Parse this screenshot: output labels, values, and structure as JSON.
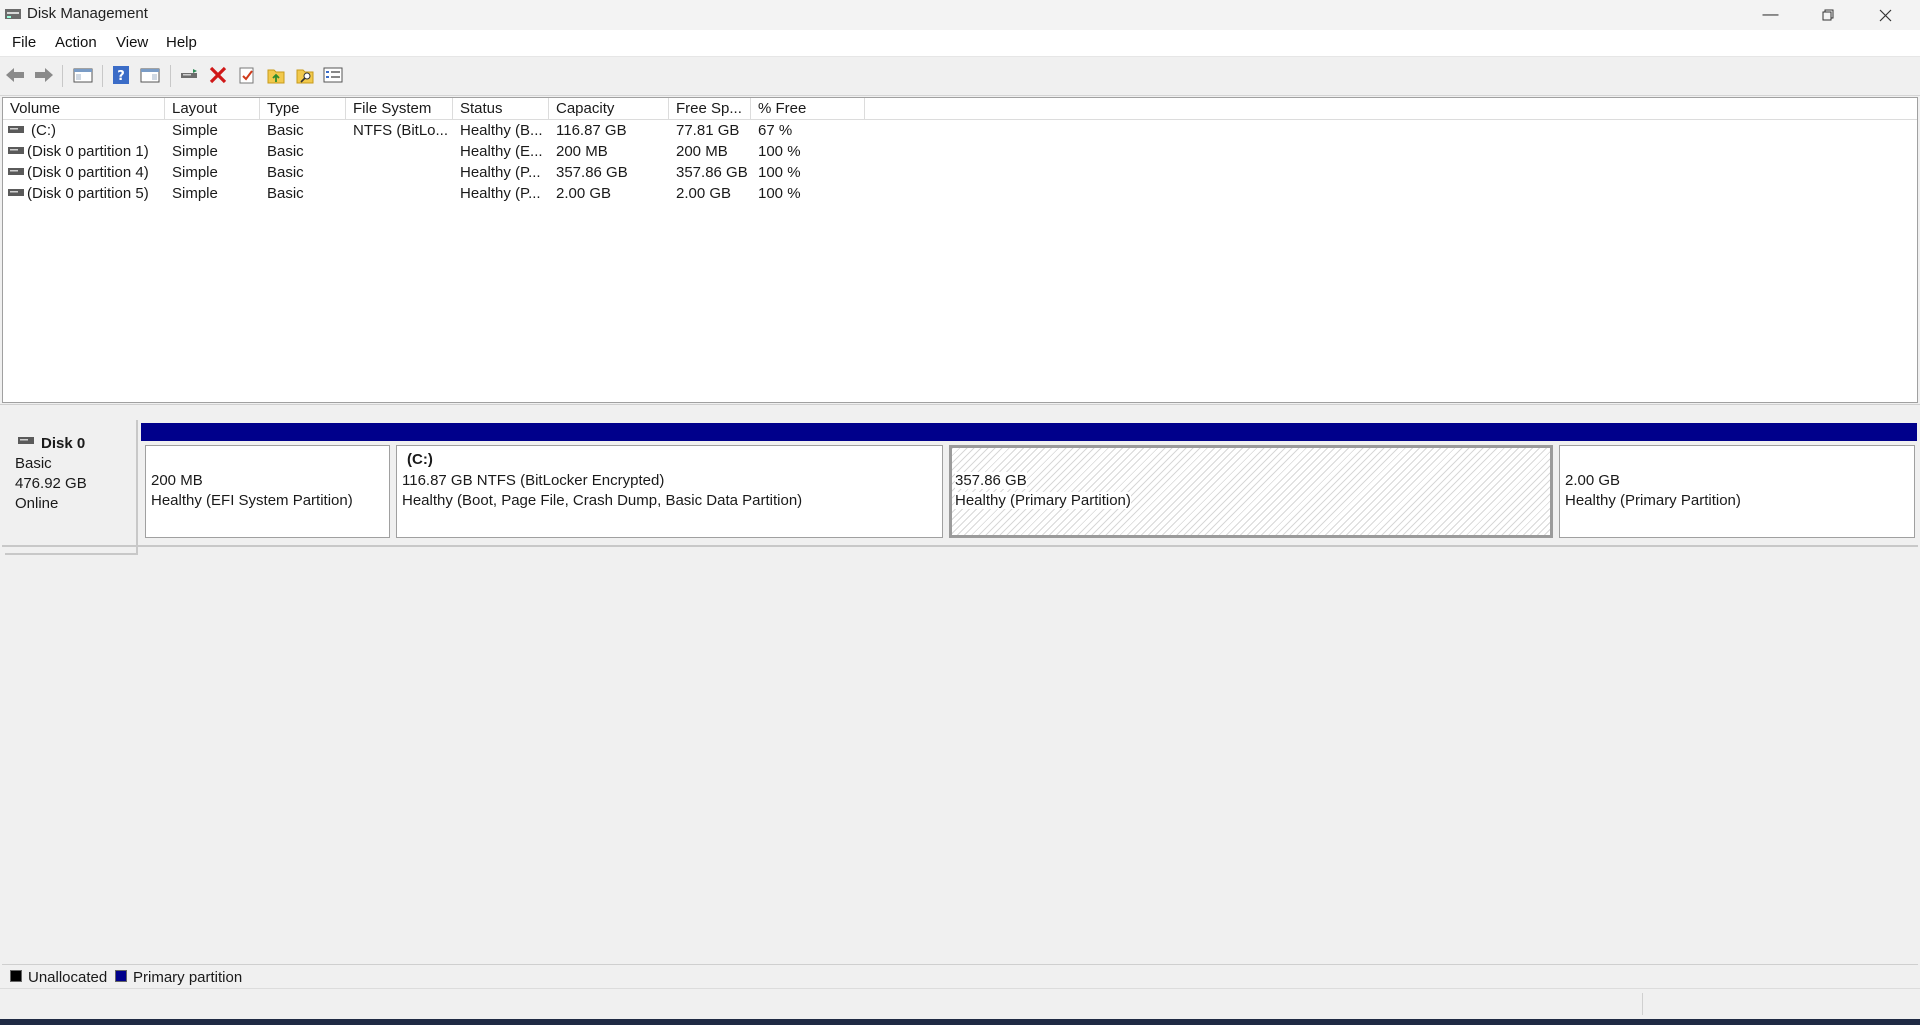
{
  "window": {
    "title": "Disk Management"
  },
  "menu": [
    "File",
    "Action",
    "View",
    "Help"
  ],
  "toolbar_icons": [
    "back-arrow-icon",
    "forward-arrow-icon",
    "console-tree-icon",
    "help-icon",
    "show-hide-icon",
    "connect-disk-icon",
    "delete-icon",
    "check-properties-icon",
    "open-folder-icon",
    "explore-folder-icon",
    "settings-list-icon"
  ],
  "columns": [
    "Volume",
    "Layout",
    "Type",
    "File System",
    "Status",
    "Capacity",
    "Free Sp...",
    "% Free"
  ],
  "volumes": [
    {
      "volume": "(C:)",
      "layout": "Simple",
      "type": "Basic",
      "fs": "NTFS (BitLo...",
      "status": "Healthy (B...",
      "capacity": "116.87 GB",
      "free": "77.81 GB",
      "pct": "67 %"
    },
    {
      "volume": "(Disk 0 partition 1)",
      "layout": "Simple",
      "type": "Basic",
      "fs": "",
      "status": "Healthy (E...",
      "capacity": "200 MB",
      "free": "200 MB",
      "pct": "100 %"
    },
    {
      "volume": "(Disk 0 partition 4)",
      "layout": "Simple",
      "type": "Basic",
      "fs": "",
      "status": "Healthy (P...",
      "capacity": "357.86 GB",
      "free": "357.86 GB",
      "pct": "100 %"
    },
    {
      "volume": "(Disk 0 partition 5)",
      "layout": "Simple",
      "type": "Basic",
      "fs": "",
      "status": "Healthy (P...",
      "capacity": "2.00 GB",
      "free": "2.00 GB",
      "pct": "100 %"
    }
  ],
  "disk": {
    "name": "Disk 0",
    "kind": "Basic",
    "size": "476.92 GB",
    "state": "Online"
  },
  "partitions": [
    {
      "name": "",
      "line1": "200 MB",
      "line2": "Healthy (EFI System Partition)"
    },
    {
      "name": "(C:)",
      "line1": "116.87 GB NTFS (BitLocker Encrypted)",
      "line2": "Healthy (Boot, Page File, Crash Dump, Basic Data Partition)"
    },
    {
      "name": "",
      "line1": "357.86 GB",
      "line2": "Healthy (Primary Partition)"
    },
    {
      "name": "",
      "line1": "2.00 GB",
      "line2": "Healthy (Primary Partition)"
    }
  ],
  "legend": [
    {
      "label": "Unallocated",
      "color": "#000000"
    },
    {
      "label": "Primary partition",
      "color": "#00008b"
    }
  ]
}
